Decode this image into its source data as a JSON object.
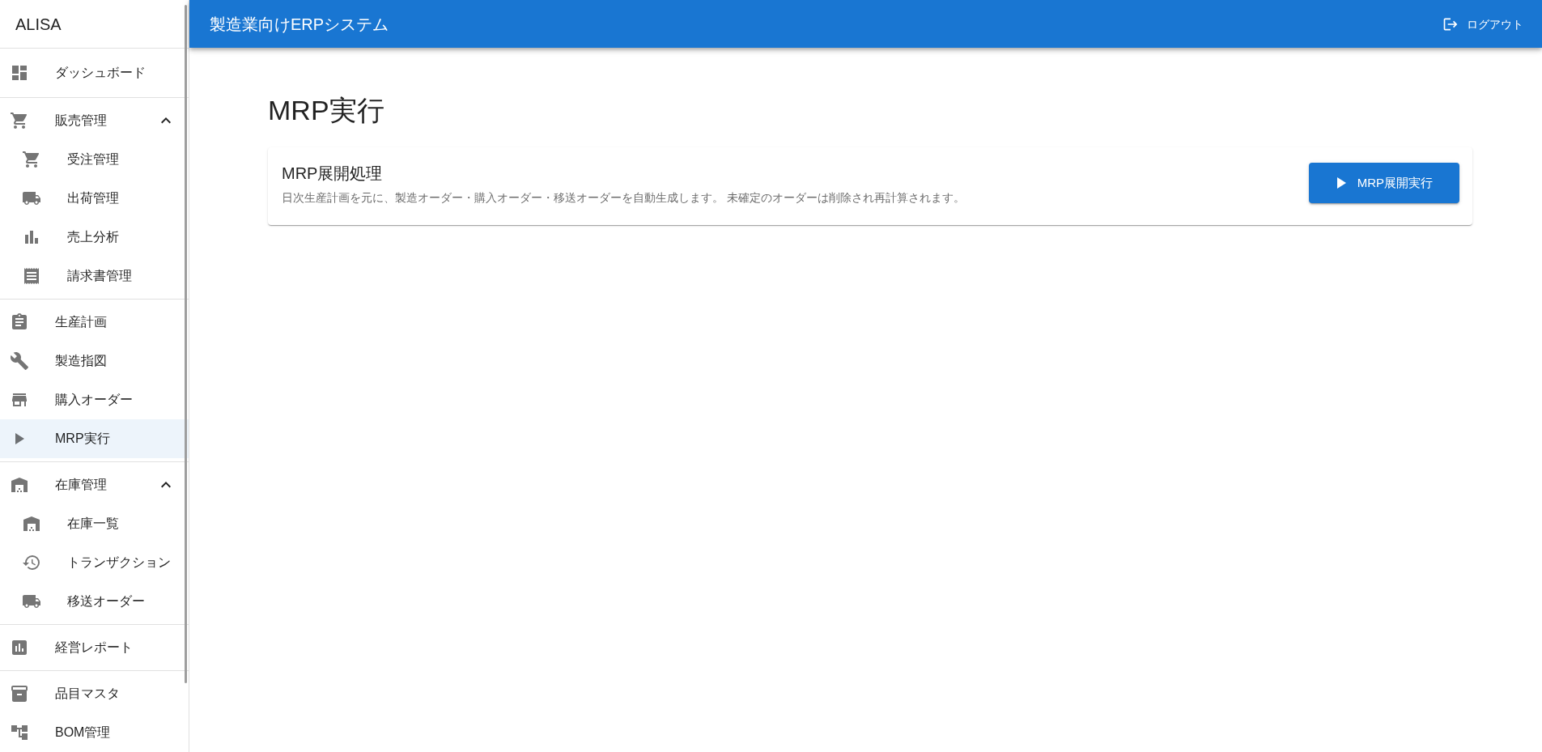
{
  "app_bar": {
    "title": "製造業向けERPシステム",
    "logout_label": "ログアウト"
  },
  "sidebar": {
    "brand": "ALISA",
    "sections": [
      {
        "items": [
          {
            "label": "ダッシュボード",
            "selected": false
          }
        ]
      },
      {
        "items": [
          {
            "label": "販売管理",
            "selected": false,
            "expanded": true,
            "children": [
              {
                "label": "受注管理",
                "selected": false
              },
              {
                "label": "出荷管理",
                "selected": false
              },
              {
                "label": "売上分析",
                "selected": false
              },
              {
                "label": "請求書管理",
                "selected": false
              }
            ]
          }
        ]
      },
      {
        "items": [
          {
            "label": "生産計画",
            "selected": false
          },
          {
            "label": "製造指図",
            "selected": false
          },
          {
            "label": "購入オーダー",
            "selected": false
          },
          {
            "label": "MRP実行",
            "selected": true
          }
        ]
      },
      {
        "items": [
          {
            "label": "在庫管理",
            "selected": false,
            "expanded": true,
            "children": [
              {
                "label": "在庫一覧",
                "selected": false
              },
              {
                "label": "トランザクション",
                "selected": false
              },
              {
                "label": "移送オーダー",
                "selected": false
              }
            ]
          }
        ]
      },
      {
        "items": [
          {
            "label": "経営レポート",
            "selected": false
          }
        ]
      },
      {
        "items": [
          {
            "label": "品目マスタ",
            "selected": false
          },
          {
            "label": "BOM管理",
            "selected": false
          }
        ]
      }
    ]
  },
  "page": {
    "title": "MRP実行",
    "card": {
      "title": "MRP展開処理",
      "description": "日次生産計画を元に、製造オーダー・購入オーダー・移送オーダーを自動生成します。 未確定のオーダーは削除され再計算されます。",
      "action_label": "MRP展開実行"
    }
  }
}
